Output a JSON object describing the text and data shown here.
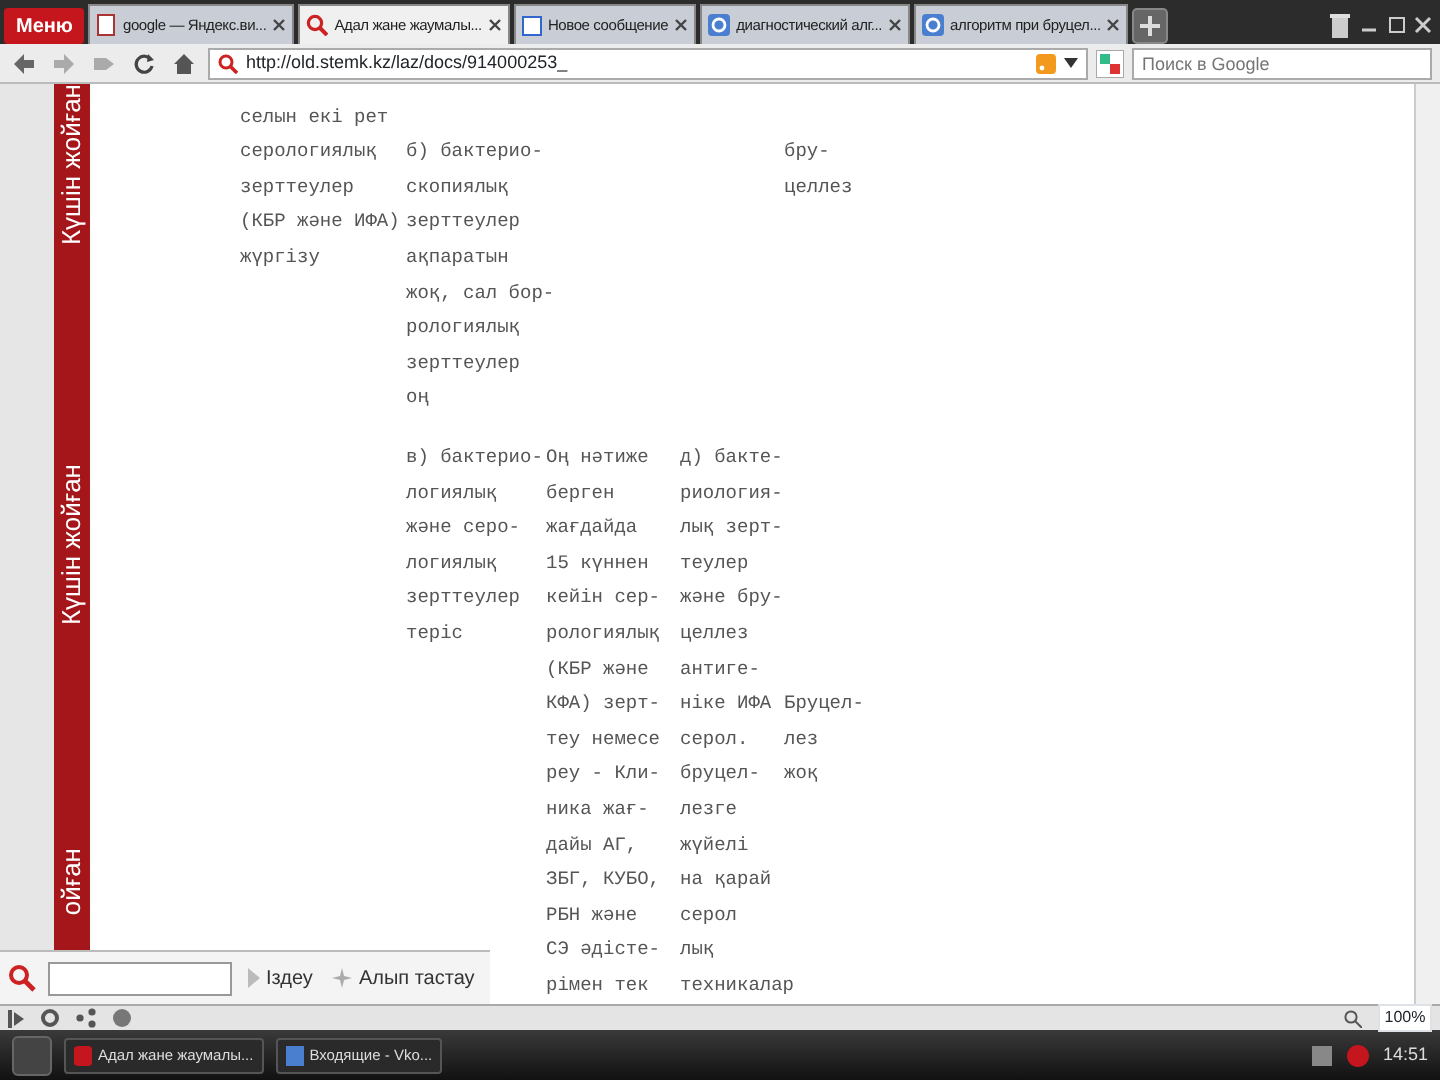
{
  "menu_button": "Меню",
  "tabs": [
    {
      "label": "google — Яндекс.ви...",
      "kind": "page",
      "selected": false
    },
    {
      "label": "Адал жане жаумалы...",
      "kind": "search",
      "selected": true
    },
    {
      "label": "Новое сообщение",
      "kind": "mail",
      "selected": false
    },
    {
      "label": "диагностический алг...",
      "kind": "google",
      "selected": false
    },
    {
      "label": "алгоритм при бруцел...",
      "kind": "google",
      "selected": false
    }
  ],
  "address": "http://old.stemk.kz/laz/docs/914000253_",
  "search": {
    "placeholder": "Поиск в Google"
  },
  "side_labels": [
    "Күшін жойған",
    "Күшін жойған",
    "ойған"
  ],
  "blocks": [
    {
      "rows": [
        {
          "column_1": "селын екі рет"
        },
        {
          "column_1": "серологиялық",
          "column_2": "б) бактерио-",
          "column_5": "бру-"
        },
        {
          "column_1": "зерттеулер",
          "column_2": "скопиялық",
          "column_5": "целлез"
        },
        {
          "column_1": "(КБР және ИФА)",
          "column_2": "зерттеулер"
        },
        {
          "column_1": "жүргізу",
          "column_2": "ақпаратын"
        },
        {
          "column_2": "жоқ, сал бор-"
        },
        {
          "column_2": "рологиялық"
        },
        {
          "column_2": "зерттеулер"
        },
        {
          "column_2": "оң"
        }
      ]
    },
    {
      "rows": [
        {
          "column_2": "в) бактерио-",
          "column_3": "Оң нәтиже",
          "column_4": "д) бакте-"
        },
        {
          "column_2": "логиялық",
          "column_3": "берген",
          "column_4": "риология-"
        },
        {
          "column_2": "және серо-",
          "column_3": "жағдайда",
          "column_4": "лық зерт-"
        },
        {
          "column_2": "логиялық",
          "column_3": "15 күннен",
          "column_4": "теулер"
        },
        {
          "column_2": "зерттеулер",
          "column_3": "кейін сер-",
          "column_4": "және бру-"
        },
        {
          "column_2": "теріс",
          "column_3": "рологиялық",
          "column_4": "целлез"
        },
        {
          "column_3": "(КБР және",
          "column_4": "антиге-"
        },
        {
          "column_3": "КФА) зерт-",
          "column_4": "ніке ИФА",
          "column_5": "Бруцел-"
        },
        {
          "column_3": "теу немесе",
          "column_4": "серол.",
          "column_5": "лез"
        },
        {
          "column_3": "реу - Кли-",
          "column_4": "бруцел-",
          "column_5": "жоқ"
        },
        {
          "column_3": "ника жағ-",
          "column_4": "лезге"
        },
        {
          "column_3": "дайы АГ,",
          "column_4": "жүйелі"
        },
        {
          "column_3": "ЗБГ, КУБО,",
          "column_4": "на қарай"
        },
        {
          "column_3": "РБН және",
          "column_4": "серол"
        },
        {
          "column_3": "СЭ әдісте-",
          "column_4": "лық"
        },
        {
          "column_3": "рімен тек",
          "column_4": "техникалар"
        }
      ]
    }
  ],
  "find_bar": {
    "search_label": "Іздеу",
    "clear_label": "Алып тастау"
  },
  "zoom": "100%",
  "taskbar": [
    {
      "label": "Адал жане жаумалы..."
    },
    {
      "label": "Входящие - Vko..."
    }
  ],
  "clock": "14:51"
}
